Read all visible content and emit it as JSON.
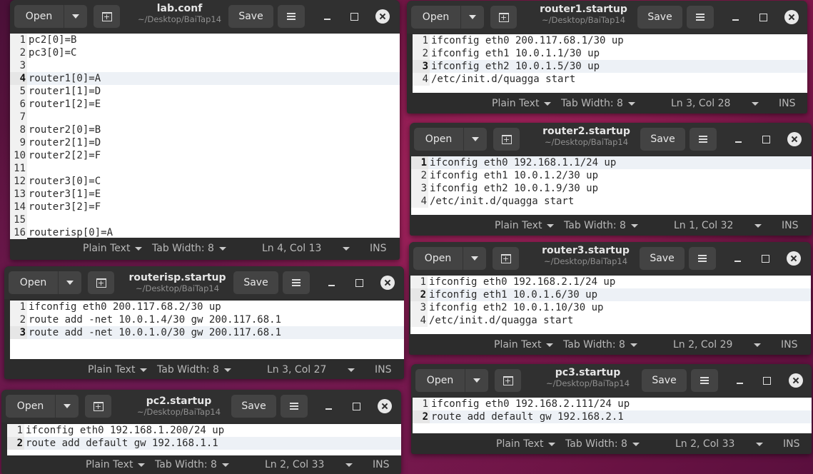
{
  "common": {
    "open_label": "Open",
    "save_label": "Save",
    "subtitle": "~/Desktop/BaiTap14",
    "plain_text": "Plain Text",
    "tab_width": "Tab Width: 8",
    "ins": "INS"
  },
  "windows": {
    "lab_conf": {
      "title": "lab.conf",
      "cursor": "Ln 4, Col 13",
      "lines": [
        {
          "n": "1",
          "text": "pc2[0]=B"
        },
        {
          "n": "2",
          "text": "pc3[0]=C"
        },
        {
          "n": "3",
          "text": ""
        },
        {
          "n": "4",
          "text": "router1[0]=A"
        },
        {
          "n": "5",
          "text": "router1[1]=D"
        },
        {
          "n": "6",
          "text": "router1[2]=E"
        },
        {
          "n": "7",
          "text": ""
        },
        {
          "n": "8",
          "text": "router2[0]=B"
        },
        {
          "n": "9",
          "text": "router2[1]=D"
        },
        {
          "n": "10",
          "text": "router2[2]=F"
        },
        {
          "n": "11",
          "text": ""
        },
        {
          "n": "12",
          "text": "router3[0]=C"
        },
        {
          "n": "13",
          "text": "router3[1]=E"
        },
        {
          "n": "14",
          "text": "router3[2]=F"
        },
        {
          "n": "15",
          "text": ""
        },
        {
          "n": "16",
          "text": "routerisp[0]=A"
        }
      ]
    },
    "routerisp": {
      "title": "routerisp.startup",
      "cursor": "Ln 3, Col 27",
      "lines": [
        {
          "n": "1",
          "text": "ifconfig eth0 200.117.68.2/30 up"
        },
        {
          "n": "2",
          "text": "route add -net 10.0.1.4/30 gw 200.117.68.1"
        },
        {
          "n": "3",
          "text": "route add -net 10.0.1.0/30 gw 200.117.68.1"
        }
      ]
    },
    "pc2": {
      "title": "pc2.startup",
      "cursor": "Ln 2, Col 33",
      "lines": [
        {
          "n": "1",
          "text": "ifconfig eth0 192.168.1.200/24 up"
        },
        {
          "n": "2",
          "text": "route add default gw 192.168.1.1"
        }
      ]
    },
    "router1": {
      "title": "router1.startup",
      "cursor": "Ln 3, Col 28",
      "lines": [
        {
          "n": "1",
          "text": "ifconfig eth0 200.117.68.1/30 up"
        },
        {
          "n": "2",
          "text": "ifconfig eth1 10.0.1.1/30 up"
        },
        {
          "n": "3",
          "text": "ifconfig eth2 10.0.1.5/30 up"
        },
        {
          "n": "4",
          "text": "/etc/init.d/quagga start"
        }
      ]
    },
    "router2": {
      "title": "router2.startup",
      "cursor": "Ln 1, Col 32",
      "lines": [
        {
          "n": "1",
          "text": "ifconfig eth0 192.168.1.1/24 up"
        },
        {
          "n": "2",
          "text": "ifconfig eth1 10.0.1.2/30 up"
        },
        {
          "n": "3",
          "text": "ifconfig eth2 10.0.1.9/30 up"
        },
        {
          "n": "4",
          "text": "/etc/init.d/quagga start"
        }
      ]
    },
    "router3": {
      "title": "router3.startup",
      "cursor": "Ln 2, Col 29",
      "lines": [
        {
          "n": "1",
          "text": "ifconfig eth0 192.168.2.1/24 up"
        },
        {
          "n": "2",
          "text": "ifconfig eth1 10.0.1.6/30 up"
        },
        {
          "n": "3",
          "text": "ifconfig eth2 10.0.1.10/30 up"
        },
        {
          "n": "4",
          "text": "/etc/init.d/quagga start"
        }
      ]
    },
    "pc3": {
      "title": "pc3.startup",
      "cursor": "Ln 2, Col 33",
      "lines": [
        {
          "n": "1",
          "text": "ifconfig eth0 192.168.2.111/24 up"
        },
        {
          "n": "2",
          "text": "route add default gw 192.168.2.1"
        }
      ]
    }
  }
}
